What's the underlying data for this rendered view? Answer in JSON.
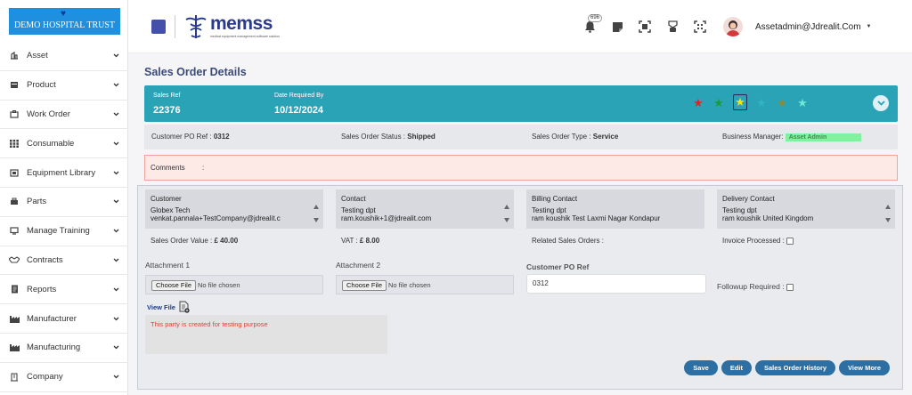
{
  "org": {
    "name": "DEMO HOSPITAL TRUST"
  },
  "brand": {
    "name": "memss",
    "tagline": "medical equipment management software solution"
  },
  "sidebar": {
    "items": [
      {
        "label": "Asset",
        "icon": "asset-icon"
      },
      {
        "label": "Product",
        "icon": "product-icon"
      },
      {
        "label": "Work Order",
        "icon": "work-order-icon"
      },
      {
        "label": "Consumable",
        "icon": "grid-icon"
      },
      {
        "label": "Equipment Library",
        "icon": "library-icon"
      },
      {
        "label": "Parts",
        "icon": "parts-icon"
      },
      {
        "label": "Manage Training",
        "icon": "monitor-icon"
      },
      {
        "label": "Contracts",
        "icon": "handshake-icon"
      },
      {
        "label": "Reports",
        "icon": "report-icon"
      },
      {
        "label": "Manufacturer",
        "icon": "factory-icon"
      },
      {
        "label": "Manufacturing",
        "icon": "factory-icon"
      },
      {
        "label": "Company",
        "icon": "company-icon"
      }
    ]
  },
  "topbar": {
    "notification_count": "696",
    "user": "Assetadmin@Jdrealit.Com"
  },
  "page": {
    "title": "Sales Order Details"
  },
  "header": {
    "sales_ref_label": "Sales Ref",
    "sales_ref_value": "22376",
    "date_label": "Date Required By",
    "date_value": "10/12/2024",
    "star_colors": [
      "#e0241c",
      "#1a9c3a",
      "#f2e21a",
      "#2ba3b7",
      "#8a8a3a",
      "#6ee6d4"
    ]
  },
  "info": {
    "customer_po_label": "Customer PO Ref :",
    "customer_po_value": "0312",
    "status_label": "Sales Order Status :",
    "status_value": "Shipped",
    "type_label": "Sales Order Type :",
    "type_value": "Service",
    "manager_label": "Business Manager:",
    "manager_value": "Asset Admin"
  },
  "comments": {
    "label": "Comments",
    "sep": ":"
  },
  "contacts": {
    "customer": {
      "title": "Customer",
      "line1": "Globex Tech",
      "line2": "venkat.pannala+TestCompany@jdrealit.c"
    },
    "contact": {
      "title": "Contact",
      "line1": "Testing dpt",
      "line2": "ram.koushik+1@jdrealit.com"
    },
    "billing": {
      "title": "Billing Contact",
      "line1": "Testing dpt",
      "line2": "ram koushik Test Laxmi Nagar Kondapur"
    },
    "delivery": {
      "title": "Delivery Contact",
      "line1": "Testing dpt",
      "line2": "ram koushik United Kingdom"
    }
  },
  "values": {
    "order_value_label": "Sales Order Value :",
    "order_value": "£ 40.00",
    "vat_label": "VAT :",
    "vat_value": "£ 8.00",
    "related_label": "Related Sales Orders :",
    "invoice_label": "Invoice Processed :"
  },
  "attachments": {
    "a1_label": "Attachment 1",
    "a2_label": "Attachment 2",
    "choose": "Choose File",
    "none": "No file chosen",
    "po_label": "Customer PO Ref",
    "po_value": "0312",
    "followup_label": "Followup Required :",
    "view_file": "View File",
    "note": "This party is created for testing purpose"
  },
  "actions": {
    "save": "Save",
    "edit": "Edit",
    "history": "Sales Order History",
    "more": "View More"
  }
}
